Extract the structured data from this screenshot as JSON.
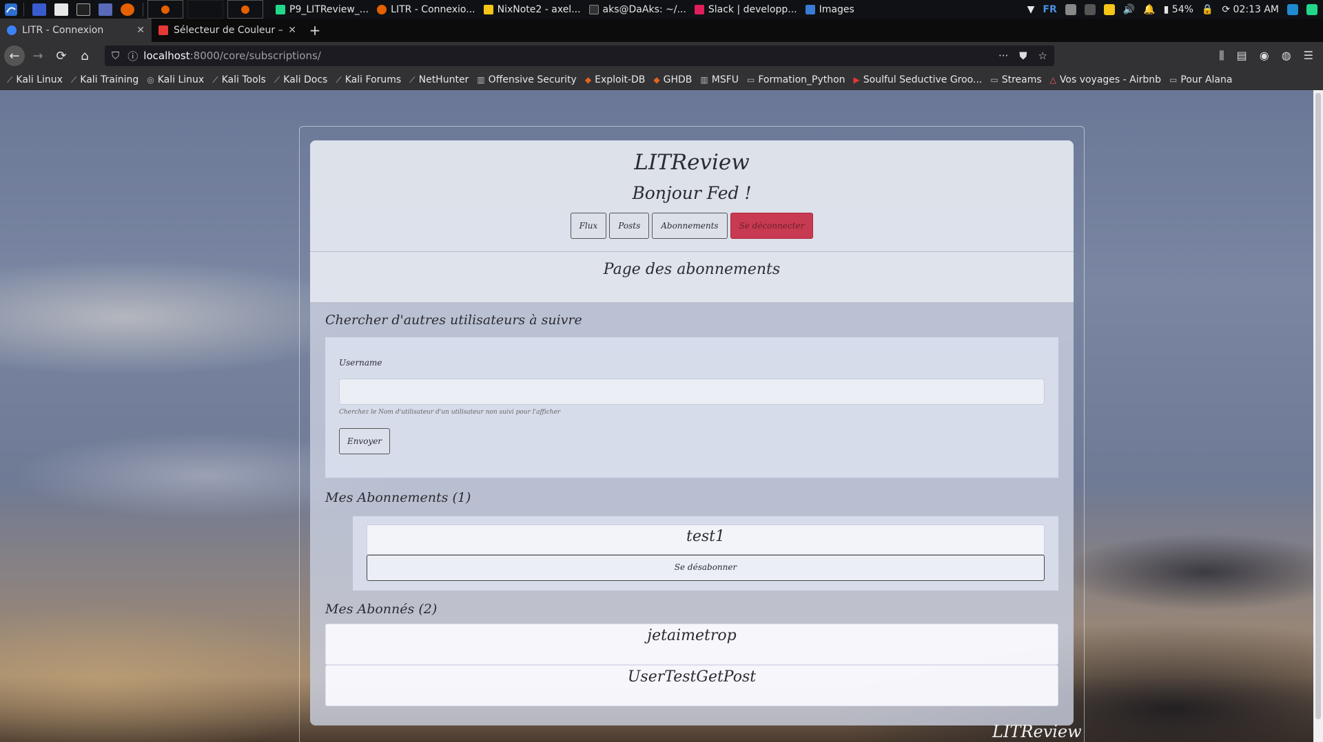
{
  "taskbar": {
    "tasks": [
      "P9_LITReview_...",
      "LITR - Connexio...",
      "NixNote2 - axel...",
      "aks@DaAks: ~/...",
      "Slack | developp...",
      "Images"
    ],
    "lang": "FR",
    "battery": "54%",
    "time": "02:13 AM"
  },
  "browser": {
    "tabs": [
      {
        "title": "LITR - Connexion",
        "active": true
      },
      {
        "title": "Sélecteur de Couleur —",
        "active": false
      }
    ],
    "url_host": "localhost",
    "url_path": ":8000/core/subscriptions/",
    "bookmarks": [
      "Kali Linux",
      "Kali Training",
      "Kali Linux",
      "Kali Tools",
      "Kali Docs",
      "Kali Forums",
      "NetHunter",
      "Offensive Security",
      "Exploit-DB",
      "GHDB",
      "MSFU",
      "Formation_Python",
      "Soulful Seductive Groo...",
      "Streams",
      "Vos voyages - Airbnb",
      "Pour Alana"
    ]
  },
  "page": {
    "site_title": "LITReview",
    "greeting": "Bonjour Fed !",
    "nav": {
      "flux": "Flux",
      "posts": "Posts",
      "abonnements": "Abonnements",
      "logout": "Se déconnecter"
    },
    "page_title": "Page des abonnements",
    "search": {
      "title": "Chercher d'autres utilisateurs à suivre",
      "label": "Username",
      "value": "",
      "help": "Cherchez le Nom d'utilisateur d'un utilisateur non suivi pour l'afficher",
      "submit": "Envoyer"
    },
    "subscriptions": {
      "title": "Mes Abonnements (1)",
      "items": [
        {
          "name": "test1",
          "action": "Se désabonner"
        }
      ]
    },
    "followers": {
      "title": "Mes Abonnés (2)",
      "items": [
        "jetaimetrop",
        "UserTestGetPost"
      ]
    },
    "footer_brand": "LITReview"
  },
  "colors": {
    "danger": "#c83a52",
    "accent": "#4a90e2"
  }
}
